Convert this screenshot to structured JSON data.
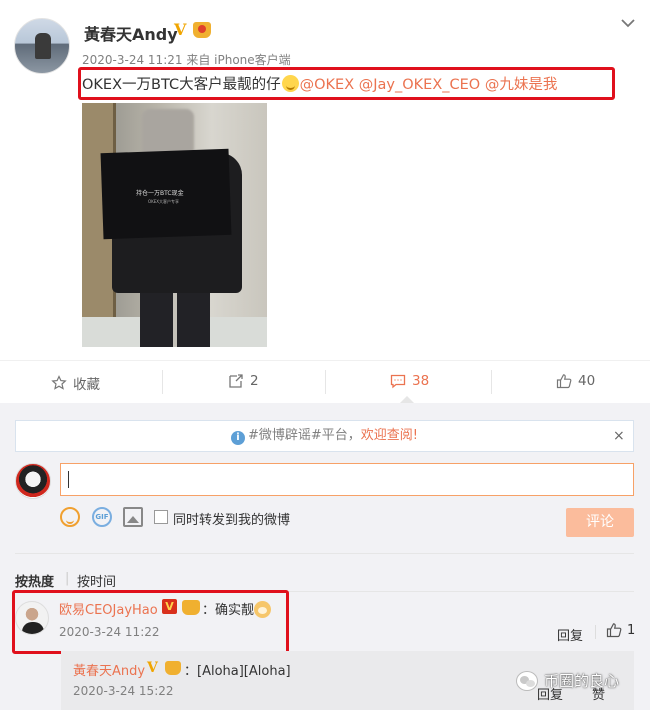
{
  "post": {
    "username": "黃春天Andy",
    "verified_mark": "V",
    "timestamp": "2020-3-24 11:21",
    "source": "来自 iPhone客户端",
    "text_main": "OKEX一万BTC大客户最靓的仔",
    "mention1": "@OKEX",
    "mention2": "@Jay_OKEX_CEO",
    "mention3": "@九妹是我",
    "photo_bag_text": "持仓一万BTC现金",
    "photo_bag_subtext": "OKEX大客户专享"
  },
  "actions": {
    "favorite_label": "收藏",
    "repost_count": "2",
    "comment_count": "38",
    "like_count": "40"
  },
  "notice": {
    "info_glyph": "i",
    "text": "#微博辟谣#平台，",
    "link_text": "欢迎查阅!",
    "close_glyph": "×"
  },
  "composer": {
    "gif_label": "GIF",
    "repost_checkbox_label": "同时转发到我的微博",
    "submit_label": "评论"
  },
  "sort": {
    "hot_label": "按热度",
    "separator": "|",
    "time_label": "按时间"
  },
  "comments": [
    {
      "username": "欧易CEOJayHao",
      "verified_mark": "V",
      "text": "：确实靓",
      "time": "2020-3-24 11:22",
      "reply_label": "回复",
      "like_count": "1"
    }
  ],
  "subcomments": [
    {
      "username": "黃春天Andy",
      "verified_mark": "V",
      "text": "：[Aloha][Aloha]",
      "time": "2020-3-24 15:22",
      "reply_label": "回复",
      "like_label": "赞"
    }
  ],
  "watermark": {
    "text": "币圈的良心"
  },
  "colors": {
    "accent": "#eb7350",
    "highlight_box": "#e0101c",
    "vip_gold": "#f0a500",
    "submit_disabled": "#fbbc9c",
    "comment_bg": "#f2f2f5"
  },
  "icons": [
    "star-icon",
    "repost-icon",
    "comment-icon",
    "thumbs-up-icon",
    "info-icon",
    "close-icon",
    "emoji-icon",
    "gif-icon",
    "image-icon",
    "chevron-down-icon",
    "wechat-watermark-icon"
  ]
}
